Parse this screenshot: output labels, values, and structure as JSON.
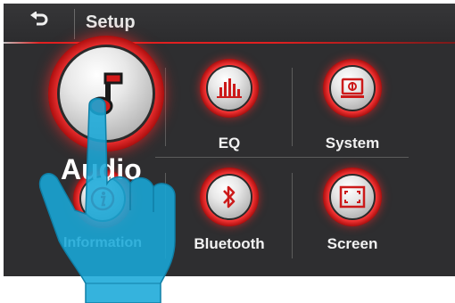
{
  "header": {
    "back_icon": "back-arrow-icon",
    "title": "Setup"
  },
  "tiles": [
    {
      "label": "Audio",
      "icon": "music-note-icon",
      "state": "pressed"
    },
    {
      "label": "EQ",
      "icon": "equalizer-icon"
    },
    {
      "label": "System",
      "icon": "system-monitor-icon"
    },
    {
      "label": "Information",
      "icon": "info-icon"
    },
    {
      "label": "Bluetooth",
      "icon": "bluetooth-icon"
    },
    {
      "label": "Screen",
      "icon": "screen-fullscreen-icon"
    }
  ],
  "colors": {
    "accent": "#e02020",
    "background": "#2e2e30",
    "hand": "#19a8d8"
  }
}
